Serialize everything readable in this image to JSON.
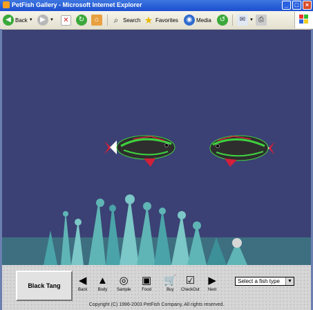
{
  "window": {
    "title": "PetFish Gallery - Microsoft Internet Explorer",
    "min_glyph": "_",
    "max_glyph": "□",
    "close_glyph": "×"
  },
  "toolbar": {
    "back_label": "Back",
    "search_label": "Search",
    "favorites_label": "Favorites",
    "media_label": "Media"
  },
  "gallery": {
    "fish_name": "Black Tang",
    "nav_items": [
      {
        "label": "Back",
        "icon": "left-arrow-icon"
      },
      {
        "label": "Body",
        "icon": "fish-body-icon"
      },
      {
        "label": "Sample",
        "icon": "sample-icon"
      },
      {
        "label": "Food",
        "icon": "food-icon"
      },
      {
        "label": "Buy",
        "icon": "cart-icon"
      },
      {
        "label": "CheckOut",
        "icon": "checkout-icon"
      },
      {
        "label": "Next",
        "icon": "right-arrow-icon"
      }
    ],
    "select_value": "Select a fish type",
    "copyright": "Copyright (C) 1996-2003 PetFish Company, All rights reserved."
  },
  "colors": {
    "water": "#3b4174",
    "fish_body": "#2e2e2e",
    "fish_stripe": "#3fd23f",
    "fish_fin": "#d3203a",
    "coral": "#5fb5b5",
    "sand": "#d6d6d6"
  }
}
